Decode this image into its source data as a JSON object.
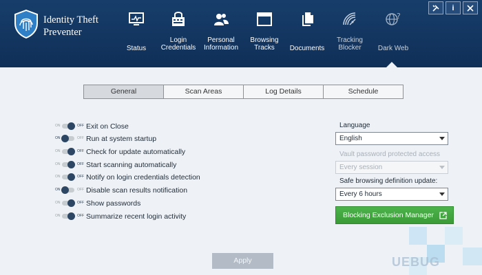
{
  "app": {
    "title_line1": "Identity Theft",
    "title_line2": "Preventer"
  },
  "nav": {
    "status": {
      "line1": "Status",
      "line2": ""
    },
    "login": {
      "line1": "Login",
      "line2": "Credentials"
    },
    "personal": {
      "line1": "Personal",
      "line2": "Information"
    },
    "browsing": {
      "line1": "Browsing",
      "line2": "Tracks"
    },
    "documents": {
      "line1": "Documents",
      "line2": ""
    },
    "tracking": {
      "line1": "Tracking",
      "line2": "Blocker"
    },
    "darkweb": {
      "line1": "Dark Web",
      "line2": ""
    }
  },
  "window_buttons": {
    "info": "i"
  },
  "tabs": [
    "General",
    "Scan Areas",
    "Log Details",
    "Schedule"
  ],
  "toggle_text": {
    "on": "ON",
    "off": "OFF"
  },
  "settings": [
    {
      "label": "Exit on Close",
      "state": "off"
    },
    {
      "label": "Run at system startup",
      "state": "on"
    },
    {
      "label": "Check for update automatically",
      "state": "off"
    },
    {
      "label": "Start scanning automatically",
      "state": "off"
    },
    {
      "label": "Notify on login credentials detection",
      "state": "off"
    },
    {
      "label": "Disable scan results notification",
      "state": "on"
    },
    {
      "label": "Show passwords",
      "state": "off"
    },
    {
      "label": "Summarize recent login activity",
      "state": "off"
    }
  ],
  "right": {
    "language_label": "Language",
    "language_value": "English",
    "vault_label": "Vault password protected access",
    "vault_value": "Every session",
    "safe_label": "Safe browsing definition update:",
    "safe_value": "Every 6 hours",
    "exclusion_button": "Blocking Exclusion Manager"
  },
  "apply_label": "Apply",
  "watermark": "UEBUG",
  "colors": {
    "header": "#173e6b",
    "accent_green": "#3a9b37",
    "background": "#eef2f6"
  }
}
